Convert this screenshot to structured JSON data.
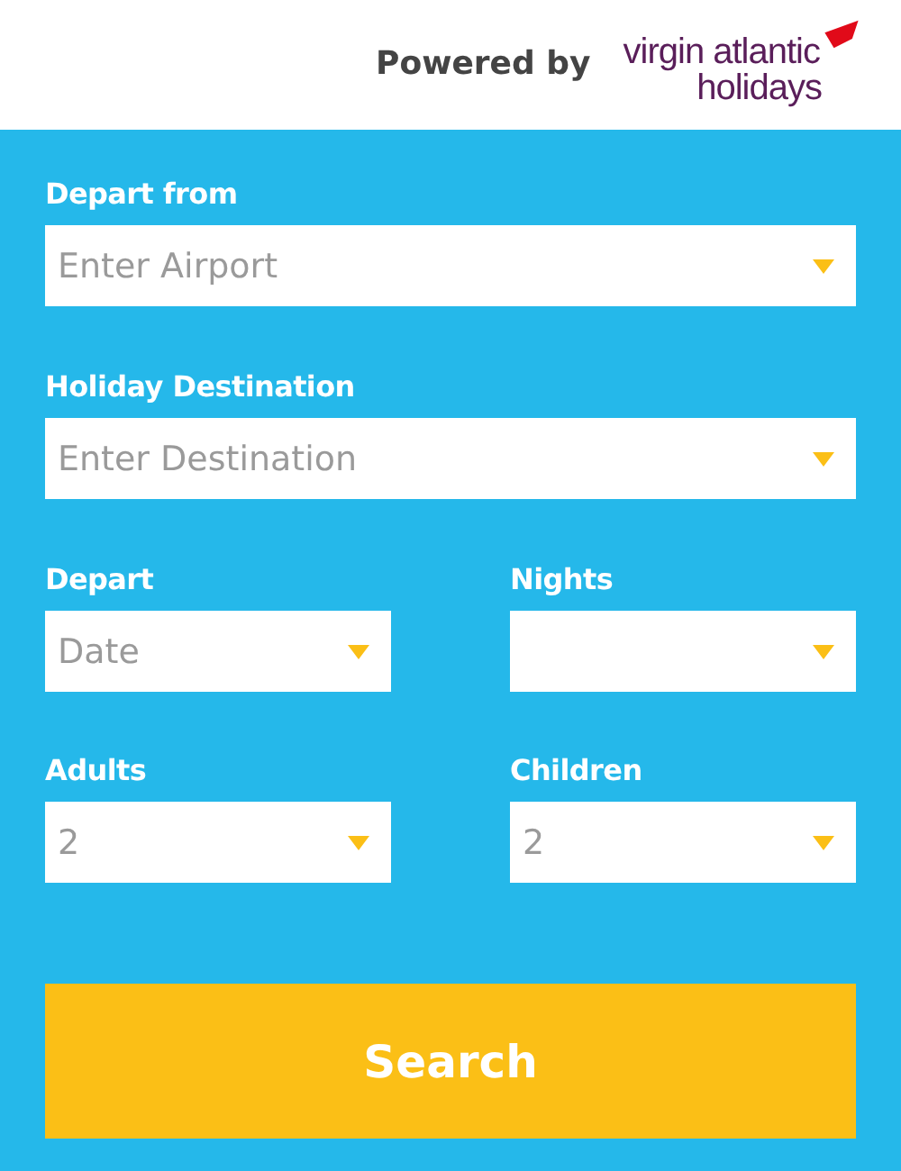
{
  "header": {
    "powered_by": "Powered by",
    "brand_line_1": "virgin atlantic",
    "brand_line_2": "holidays"
  },
  "rows": [
    [
      {
        "label": "Depart from",
        "placeholder": "Enter Airport"
      }
    ],
    [
      {
        "label": "Holiday Destination",
        "placeholder": "Enter Destination"
      }
    ],
    [
      {
        "label": "Depart",
        "placeholder": "Date"
      },
      {
        "label": "Nights"
      }
    ],
    [
      {
        "label": "Adults",
        "value": "2"
      },
      {
        "label": "Children",
        "value": "2"
      }
    ]
  ],
  "search_button": "Search"
}
